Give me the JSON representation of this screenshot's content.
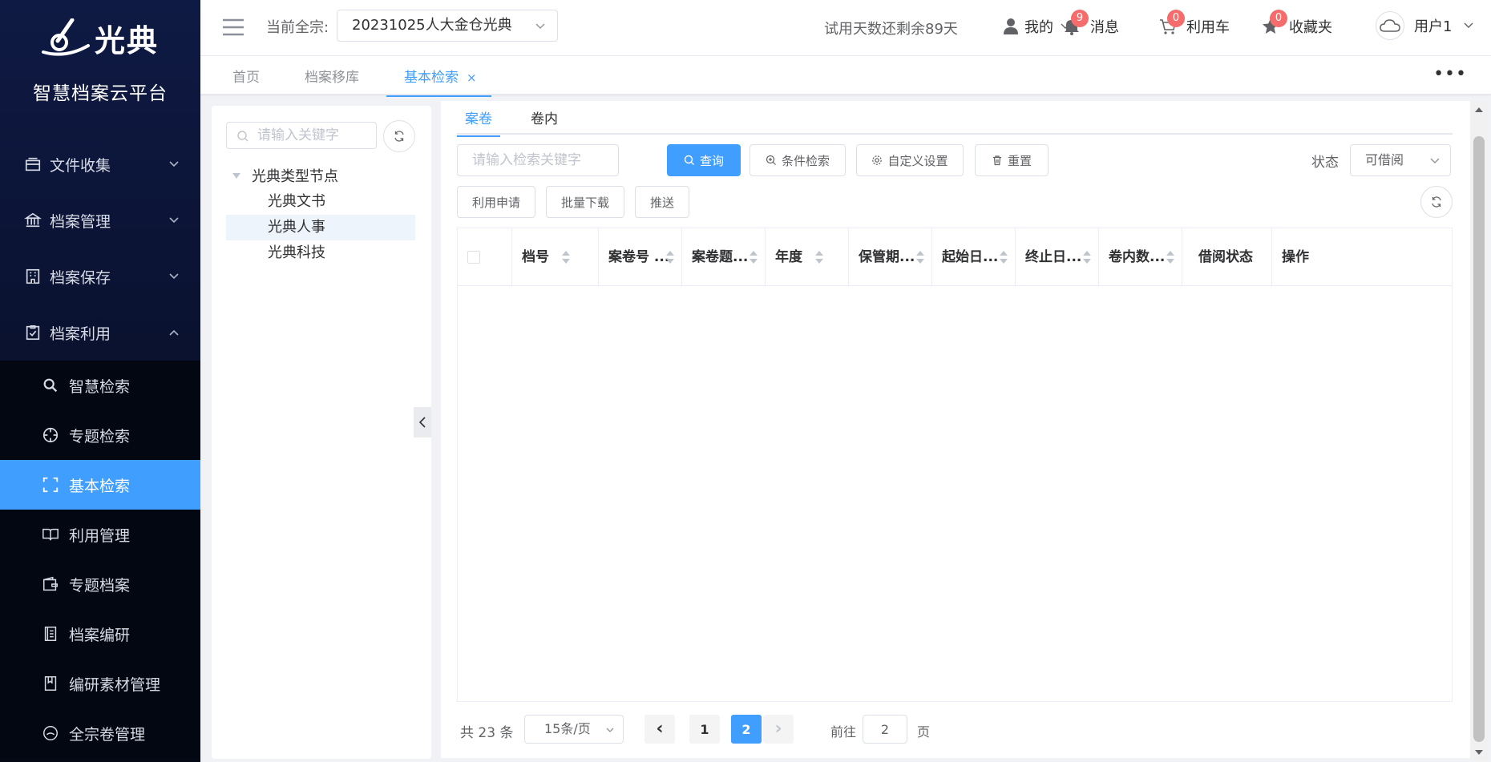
{
  "brand": {
    "logo_text": "光典",
    "platform_name": "智慧档案云平台"
  },
  "sidebar": {
    "items": [
      {
        "label": "文件收集",
        "icon": "inbox-icon",
        "expanded": false
      },
      {
        "label": "档案管理",
        "icon": "bank-icon",
        "expanded": false
      },
      {
        "label": "档案保存",
        "icon": "building-icon",
        "expanded": false
      },
      {
        "label": "档案利用",
        "icon": "clipboard-check-icon",
        "expanded": true
      }
    ],
    "subitems": [
      {
        "label": "智慧检索",
        "icon": "search-icon"
      },
      {
        "label": "专题检索",
        "icon": "crosshair-icon"
      },
      {
        "label": "基本检索",
        "icon": "scan-icon",
        "active": true
      },
      {
        "label": "利用管理",
        "icon": "book-open-icon"
      },
      {
        "label": "专题档案",
        "icon": "wallet-icon"
      },
      {
        "label": "档案编研",
        "icon": "notebook-icon"
      },
      {
        "label": "编研素材管理",
        "icon": "bookmark-book-icon"
      },
      {
        "label": "全宗卷管理",
        "icon": "smile-circle-icon"
      }
    ]
  },
  "header": {
    "current_fonds_label": "当前全宗:",
    "current_fonds_value": "20231025人大金仓光典",
    "trial_text": "试用天数还剩余89天",
    "mine_label": "我的",
    "messages": {
      "label": "消息",
      "badge": "9"
    },
    "cart": {
      "label": "利用车",
      "badge": "0"
    },
    "favorites": {
      "label": "收藏夹",
      "badge": "0"
    },
    "user_label": "用户1"
  },
  "page_tabs": [
    {
      "label": "首页"
    },
    {
      "label": "档案移库"
    },
    {
      "label": "基本检索",
      "active": true,
      "close": "×"
    }
  ],
  "more_label": "•••",
  "tree": {
    "search_placeholder": "请输入关键字",
    "root_label": "光典类型节点",
    "children": [
      "光典文书",
      "光典人事",
      "光典科技"
    ],
    "selected_index": 1
  },
  "main": {
    "sub_tabs": [
      {
        "label": "案卷",
        "active": true
      },
      {
        "label": "卷内"
      }
    ],
    "keyword_placeholder": "请输入检索关键字",
    "buttons": {
      "query": "查询",
      "condition_search": "条件检索",
      "custom_settings": "自定义设置",
      "reset": "重置",
      "apply": "利用申请",
      "batch_download": "批量下载",
      "push": "推送"
    },
    "status_label": "状态",
    "status_value": "可借阅",
    "columns": [
      "档号",
      "案卷号 ...",
      "案卷题...",
      "年度",
      "保管期...",
      "起始日...",
      "终止日...",
      "卷内数...",
      "借阅状态",
      "操作"
    ]
  },
  "pagination": {
    "total_text": "共 23 条",
    "page_size": "15条/页",
    "prev": "‹",
    "next": "›",
    "pages": [
      "1",
      "2"
    ],
    "current_page": "2",
    "goto_prefix": "前往",
    "goto_value": "2",
    "goto_suffix": "页"
  },
  "colors": {
    "accent": "#409eff",
    "sidebar_bg": "#0f1a44",
    "badge": "#f56c6c"
  }
}
